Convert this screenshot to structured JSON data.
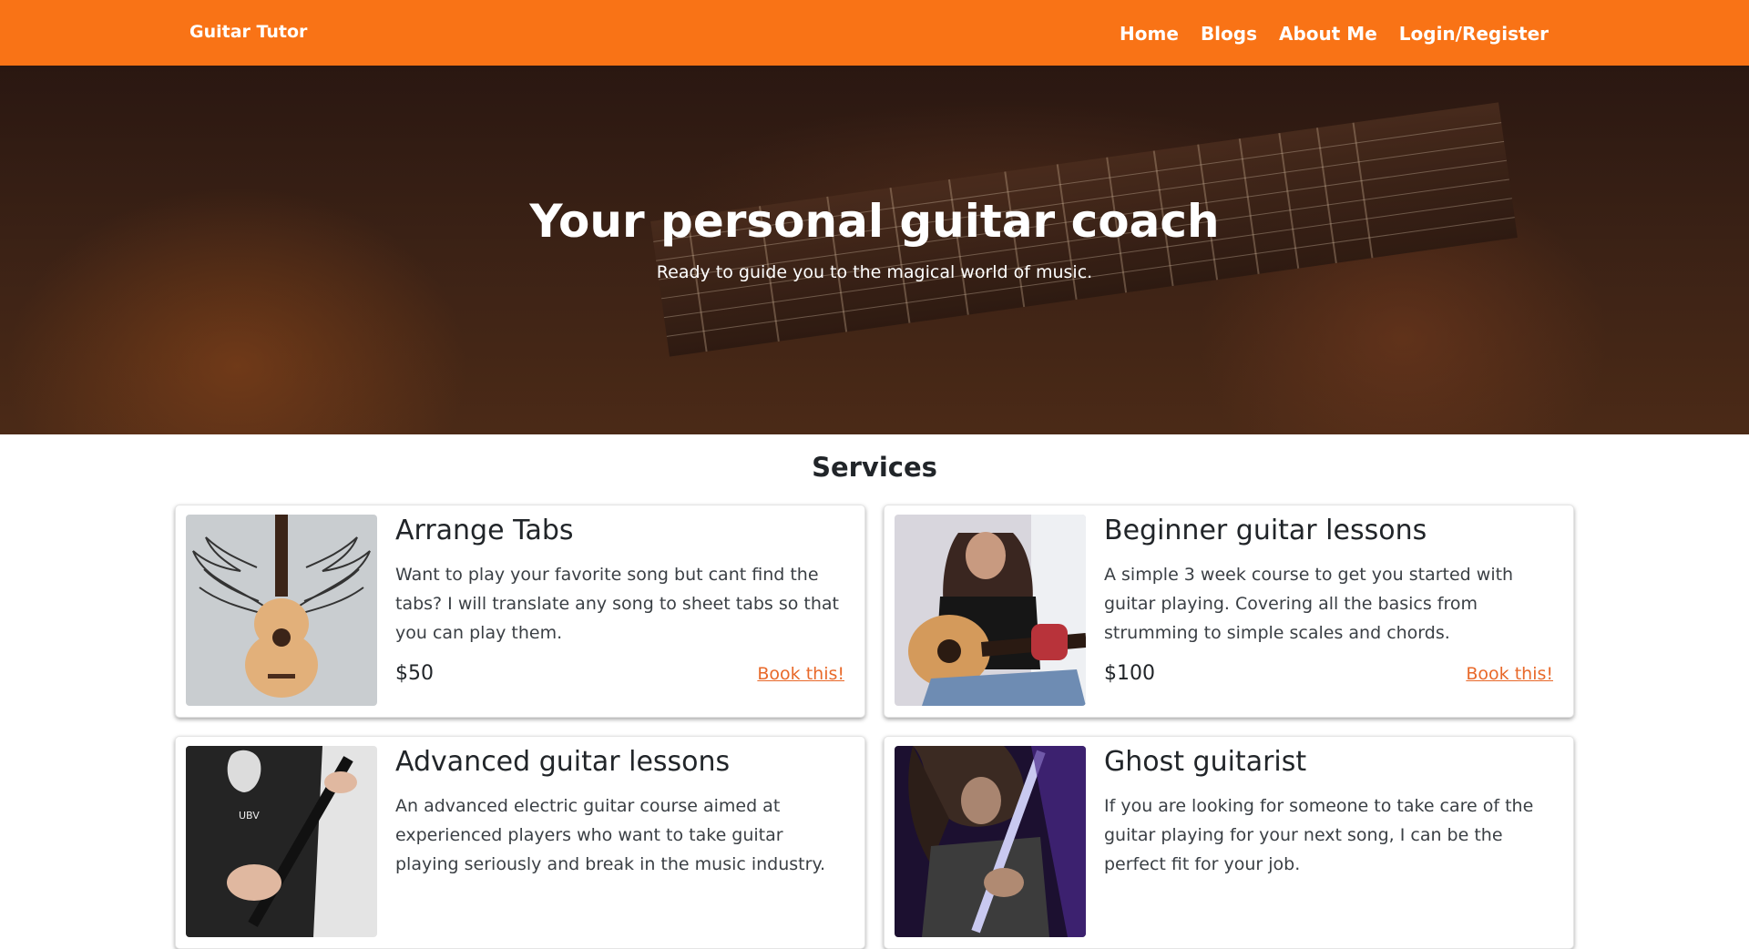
{
  "nav": {
    "brand": "Guitar Tutor",
    "links": [
      "Home",
      "Blogs",
      "About Me",
      "Login/Register"
    ]
  },
  "hero": {
    "title": "Your personal guitar coach",
    "subtitle": "Ready to guide you to the magical world of music."
  },
  "services": {
    "heading": "Services",
    "cards": [
      {
        "title": "Arrange Tabs",
        "description": "Want to play your favorite song but cant find the tabs? I will translate any song to sheet tabs so that you can play them.",
        "price": "$50",
        "link": "Book this!"
      },
      {
        "title": "Beginner guitar lessons",
        "description": "A simple 3 week course to get you started with guitar playing. Covering all the basics from strumming to simple scales and chords.",
        "price": "$100",
        "link": "Book this!"
      },
      {
        "title": "Advanced guitar lessons",
        "description": "An advanced electric guitar course aimed at experienced players who want to take guitar playing seriously and break in the music industry.",
        "price": "",
        "link": ""
      },
      {
        "title": "Ghost guitarist",
        "description": "If you are looking for someone to take care of the guitar playing for your next song, I can be the perfect fit for your job.",
        "price": "",
        "link": ""
      }
    ]
  },
  "colors": {
    "accent": "#f97316",
    "link": "#e8692a"
  }
}
